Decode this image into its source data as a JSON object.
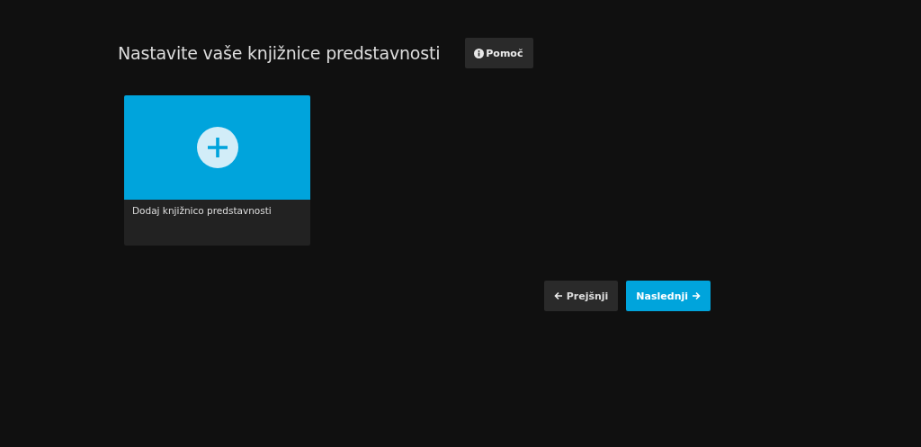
{
  "title": "Nastavite vaše knjižnice predstavnosti",
  "help_button": {
    "label": "Pomoč"
  },
  "libraries": [
    {
      "kind": "add",
      "label": "Dodaj knjižnico predstavnosti"
    }
  ],
  "nav_buttons": [
    {
      "kind": "back",
      "label": "Prejšnji"
    },
    {
      "kind": "next",
      "label": "Naslednji"
    }
  ]
}
